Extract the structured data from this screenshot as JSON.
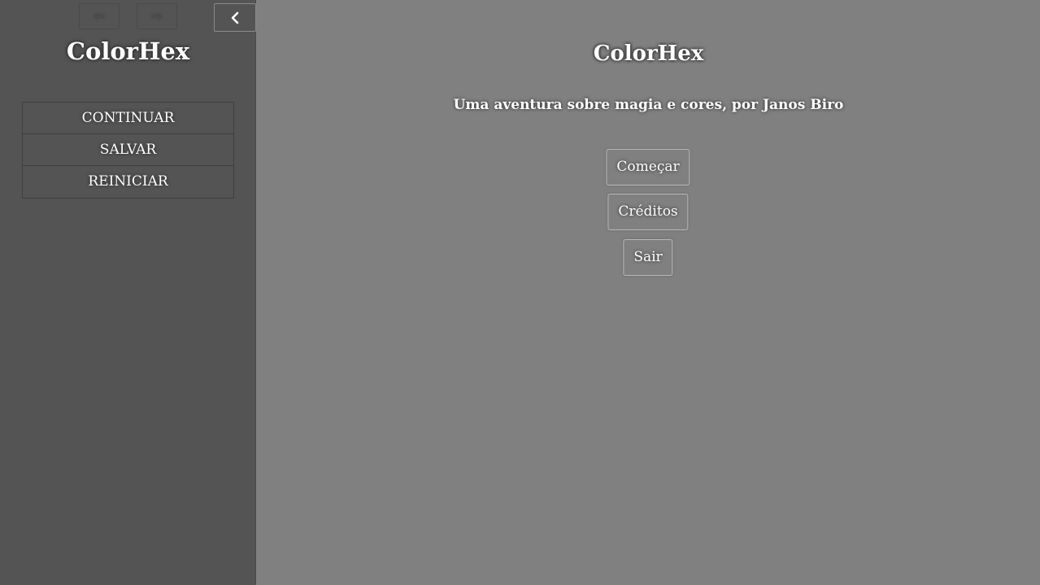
{
  "sidebar": {
    "title": "ColorHex",
    "history_back_icon": "arrow-left-circle-icon",
    "history_forward_icon": "arrow-right-circle-icon",
    "toggle_icon": "chevron-left-icon",
    "menu": [
      {
        "label": "CONTINUAR"
      },
      {
        "label": "SALVAR"
      },
      {
        "label": "REINICIAR"
      }
    ]
  },
  "passage": {
    "title": "ColorHex",
    "subtitle": "Uma aventura sobre magia e cores, por Janos Biro",
    "buttons": [
      {
        "label": "Começar"
      },
      {
        "label": "Créditos"
      },
      {
        "label": "Sair"
      }
    ]
  },
  "colors": {
    "sidebar_bg": "#545454",
    "main_bg": "#808080",
    "text": "#ffffff"
  }
}
